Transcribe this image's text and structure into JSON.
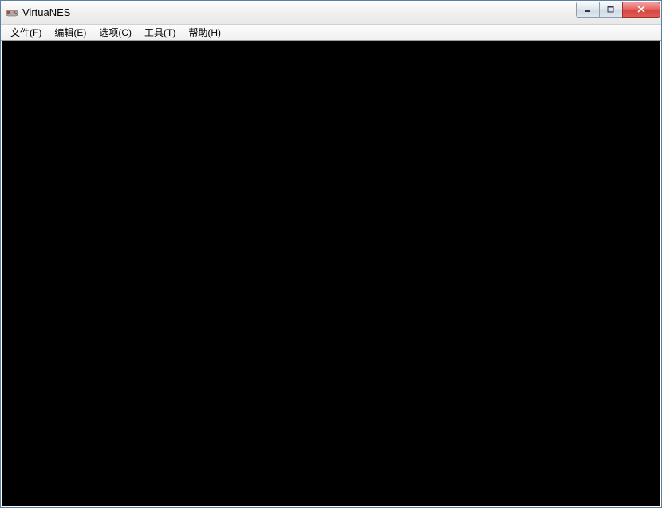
{
  "window": {
    "title": "VirtuaNES"
  },
  "menubar": {
    "items": [
      {
        "label": "文件(F)"
      },
      {
        "label": "编辑(E)"
      },
      {
        "label": "选项(C)"
      },
      {
        "label": "工具(T)"
      },
      {
        "label": "帮助(H)"
      }
    ]
  }
}
